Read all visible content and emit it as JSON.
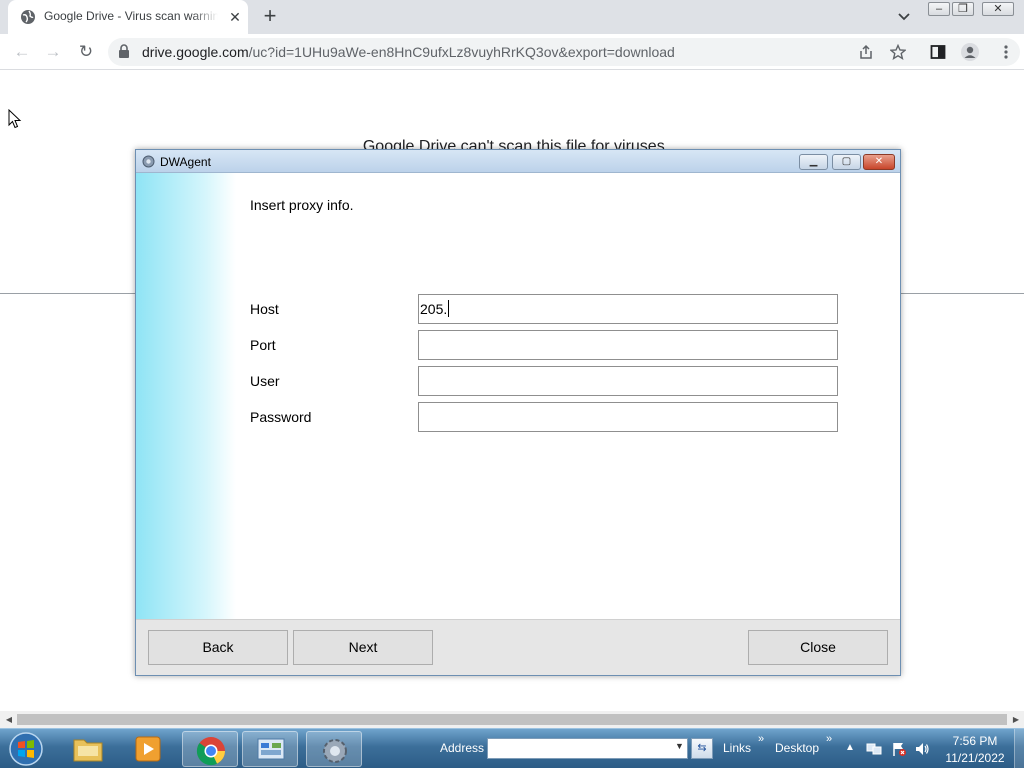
{
  "browser": {
    "tab": {
      "title": "Google Drive - Virus scan warning",
      "close_icon": "close-icon"
    },
    "new_tab_label": "+",
    "url_host": "drive.google.com",
    "url_rest": "/uc?id=1UHu9aWe-en8HnC9ufxLz8vuyhRrKQ3ov&export=download"
  },
  "page": {
    "heading": "Google Drive can't scan this file for viruses."
  },
  "dialog": {
    "title": "DWAgent",
    "prompt": "Insert proxy info.",
    "fields": [
      {
        "label": "Host",
        "value": "205."
      },
      {
        "label": "Port",
        "value": ""
      },
      {
        "label": "User",
        "value": ""
      },
      {
        "label": "Password",
        "value": ""
      }
    ],
    "buttons": {
      "back": "Back",
      "next": "Next",
      "close": "Close"
    }
  },
  "taskbar": {
    "address_label": "Address",
    "address_value": "",
    "links_label": "Links",
    "desktop_label": "Desktop",
    "time": "7:56 PM",
    "date": "11/21/2022"
  },
  "colors": {
    "chrome_tabbar": "#dee1e6",
    "dialog_accent": "#8fe4f5",
    "taskbar": "#3c6f9a"
  }
}
